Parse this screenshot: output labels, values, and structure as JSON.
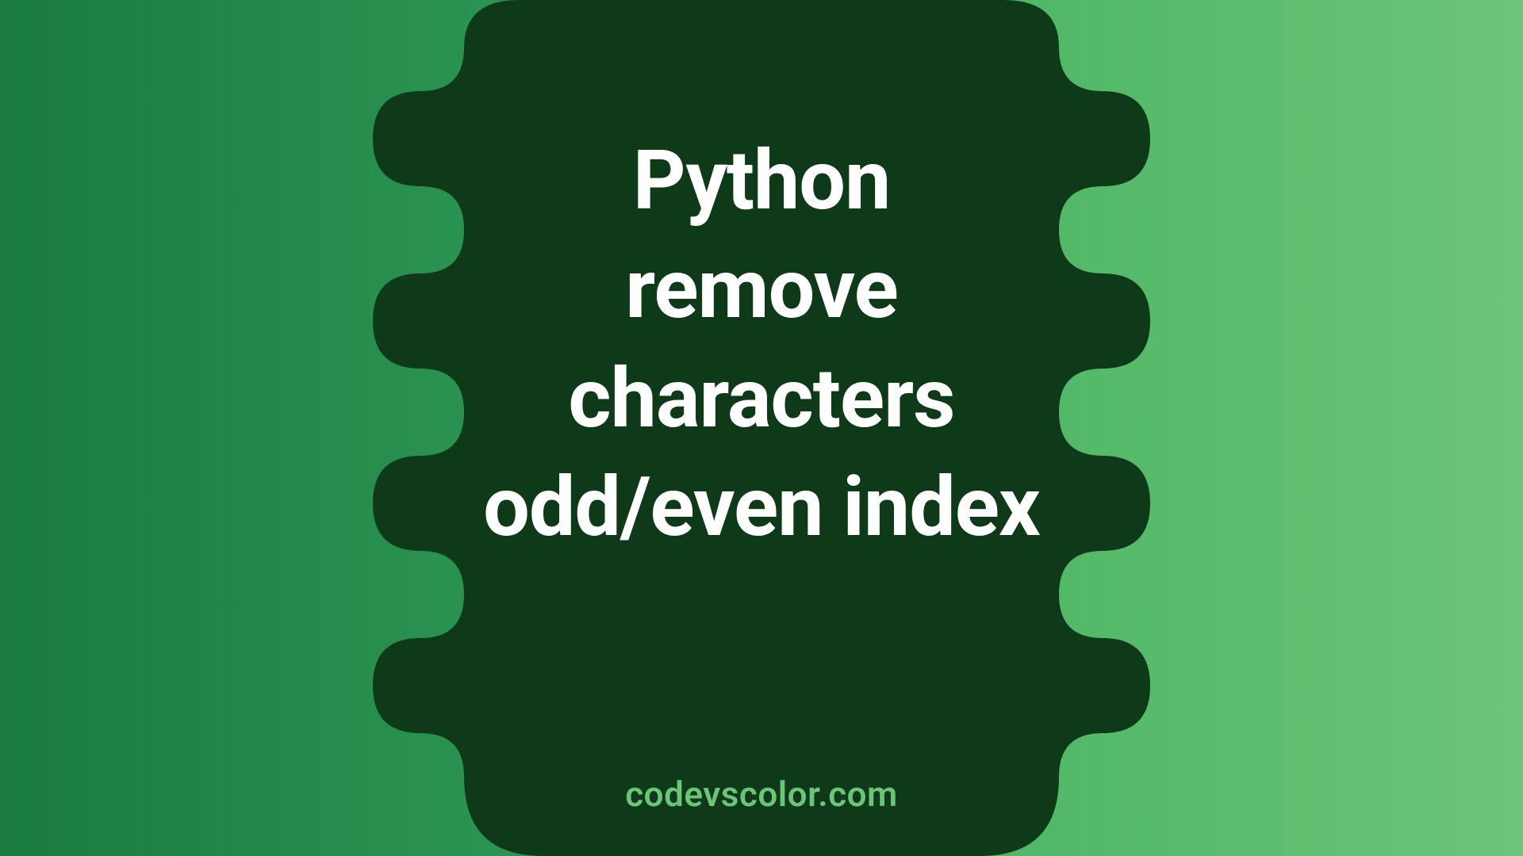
{
  "title_lines": [
    "Python",
    "remove",
    "characters",
    "odd/even index"
  ],
  "site": "codevscolor.com",
  "colors": {
    "blob": "#0f3a1a",
    "text": "#ffffff",
    "site": "#6cc479",
    "bg_from": "#1a7a3f",
    "bg_to": "#6cc479"
  }
}
